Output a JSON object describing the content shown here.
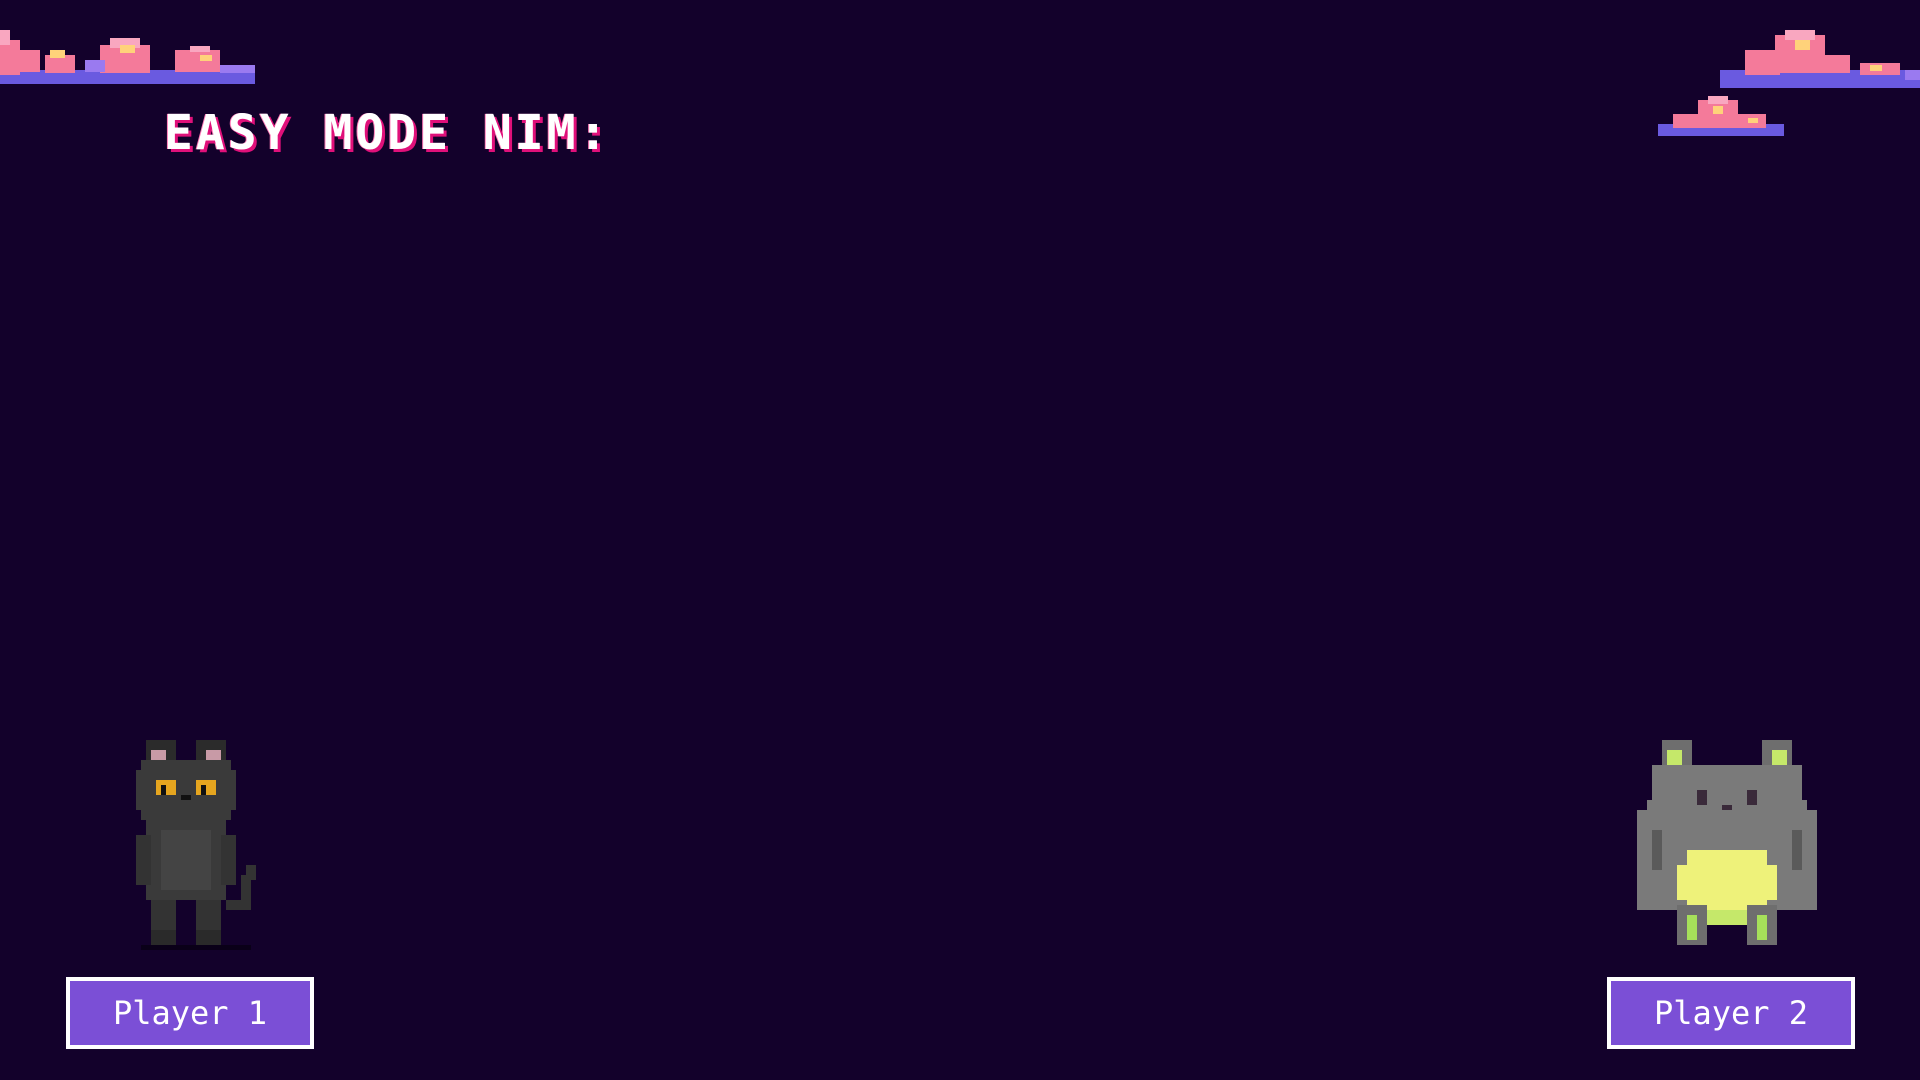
{
  "game": {
    "title": "EASY MODE NIM:"
  },
  "players": [
    {
      "label": "Player 1",
      "sprite": "black-cat-sprite"
    },
    {
      "label": "Player 2",
      "sprite": "gray-chubby-cat-sprite"
    }
  ],
  "colors": {
    "background": "#13012b",
    "button_fill": "#7b4fd6",
    "button_border": "#ffffff",
    "title_shadow": "#e0107a",
    "cloud_pink": "#f47a9a",
    "cloud_blue": "#6a5ae0"
  },
  "decorations": [
    "cloud-top-left",
    "cloud-top-right",
    "cloud-small-right"
  ]
}
